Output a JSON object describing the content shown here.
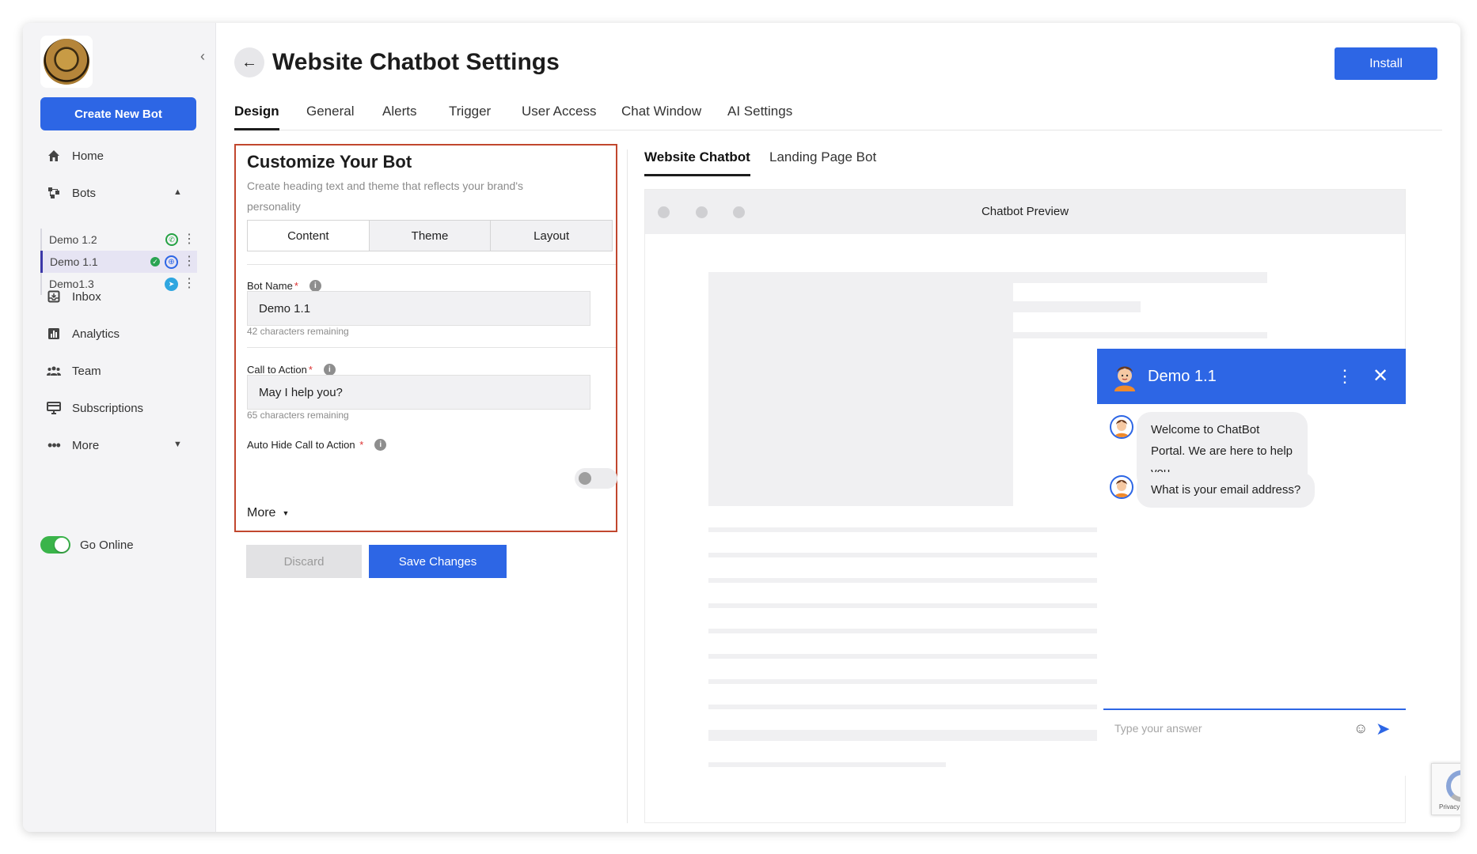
{
  "sidebar": {
    "create_btn": "Create New Bot",
    "nav": {
      "home": "Home",
      "bots": "Bots",
      "inbox": "Inbox",
      "analytics": "Analytics",
      "team": "Team",
      "subscriptions": "Subscriptions",
      "more": "More"
    },
    "bots": [
      {
        "name": "Demo 1.2",
        "channel": "whatsapp-icon"
      },
      {
        "name": "Demo 1.1",
        "channel": "globe-icon",
        "active": true
      },
      {
        "name": "Demo1.3",
        "channel": "telegram-icon"
      }
    ],
    "go_online": "Go Online"
  },
  "header": {
    "title": "Website Chatbot Settings",
    "install": "Install"
  },
  "tabs": [
    "Design",
    "General",
    "Alerts",
    "Trigger",
    "User Access",
    "Chat Window",
    "AI Settings"
  ],
  "customize": {
    "title": "Customize Your Bot",
    "description": "Create heading text and theme that reflects your brand's personality",
    "segments": [
      "Content",
      "Theme",
      "Layout"
    ],
    "bot_name_label": "Bot Name",
    "bot_name_value": "Demo 1.1",
    "bot_name_hint": "42 characters remaining",
    "cta_label": "Call to Action",
    "cta_value": "May I help you?",
    "cta_hint": "65 characters remaining",
    "auto_hide_label": "Auto Hide Call to Action",
    "auto_hide_on": false,
    "more": "More"
  },
  "actions": {
    "discard": "Discard",
    "save": "Save Changes"
  },
  "preview": {
    "tabs": [
      "Website Chatbot",
      "Landing Page Bot"
    ],
    "window_title": "Chatbot Preview",
    "chat": {
      "bot_name": "Demo 1.1",
      "messages": [
        "Welcome to ChatBot Portal. We are here to help you.",
        "What is your email address?"
      ],
      "input_placeholder": "Type your answer"
    }
  },
  "recaptcha": {
    "text": "Privacy - Terms"
  },
  "colors": {
    "accent": "#2d66e5",
    "highlight_border": "#c1472e",
    "online": "#3ab44a"
  }
}
